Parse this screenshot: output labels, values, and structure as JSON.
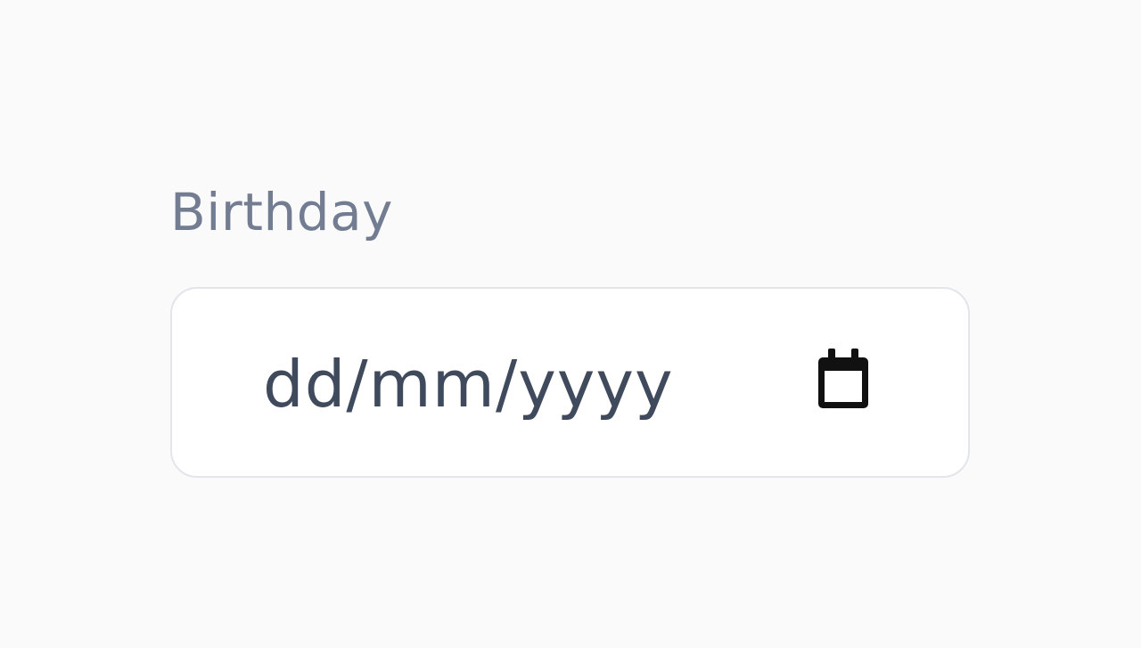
{
  "birthday_field": {
    "label": "Birthday",
    "placeholder": "dd/mm/yyyy",
    "icon": "calendar-icon"
  },
  "colors": {
    "background": "#fafafb",
    "label": "#737d92",
    "input_background": "#ffffff",
    "input_border": "#e3e5eb",
    "placeholder_text": "#3f4a5d",
    "icon": "#111111"
  }
}
